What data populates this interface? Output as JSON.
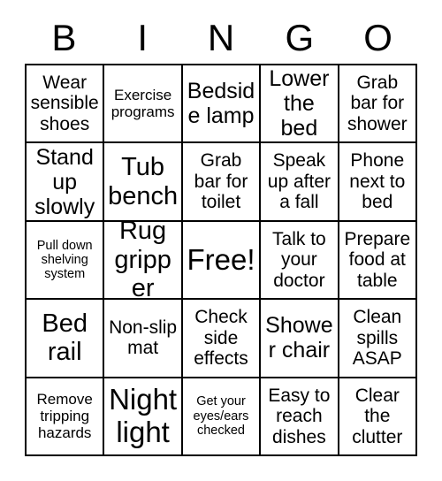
{
  "card": {
    "title": "BINGO",
    "header_letters": [
      "B",
      "I",
      "N",
      "G",
      "O"
    ],
    "grid_size": "5x5",
    "colors": {
      "background": "#ffffff",
      "border": "#000000",
      "text": "#000000"
    },
    "cells": [
      {
        "row": 1,
        "col": 1,
        "text": "Wear sensible shoes",
        "size": "m",
        "free": false
      },
      {
        "row": 1,
        "col": 2,
        "text": "Exercise programs",
        "size": "s",
        "free": false
      },
      {
        "row": 1,
        "col": 3,
        "text": "Bedside lamp",
        "size": "l",
        "free": false
      },
      {
        "row": 1,
        "col": 4,
        "text": "Lower the bed",
        "size": "l",
        "free": false
      },
      {
        "row": 1,
        "col": 5,
        "text": "Grab bar for shower",
        "size": "m",
        "free": false
      },
      {
        "row": 2,
        "col": 1,
        "text": "Stand up slowly",
        "size": "l",
        "free": false
      },
      {
        "row": 2,
        "col": 2,
        "text": "Tub bench",
        "size": "xl",
        "free": false
      },
      {
        "row": 2,
        "col": 3,
        "text": "Grab bar for toilet",
        "size": "m",
        "free": false
      },
      {
        "row": 2,
        "col": 4,
        "text": "Speak up after a fall",
        "size": "m",
        "free": false
      },
      {
        "row": 2,
        "col": 5,
        "text": "Phone next to bed",
        "size": "m",
        "free": false
      },
      {
        "row": 3,
        "col": 1,
        "text": "Pull down shelving system",
        "size": "xs",
        "free": false
      },
      {
        "row": 3,
        "col": 2,
        "text": "Rug gripper",
        "size": "xl",
        "free": false
      },
      {
        "row": 3,
        "col": 3,
        "text": "Free!",
        "size": "xxl",
        "free": true
      },
      {
        "row": 3,
        "col": 4,
        "text": "Talk to your doctor",
        "size": "m",
        "free": false
      },
      {
        "row": 3,
        "col": 5,
        "text": "Prepare food at table",
        "size": "m",
        "free": false
      },
      {
        "row": 4,
        "col": 1,
        "text": "Bed rail",
        "size": "xl",
        "free": false
      },
      {
        "row": 4,
        "col": 2,
        "text": "Non-slip mat",
        "size": "m",
        "free": false
      },
      {
        "row": 4,
        "col": 3,
        "text": "Check side effects",
        "size": "m",
        "free": false
      },
      {
        "row": 4,
        "col": 4,
        "text": "Shower chair",
        "size": "l",
        "free": false
      },
      {
        "row": 4,
        "col": 5,
        "text": "Clean spills ASAP",
        "size": "m",
        "free": false
      },
      {
        "row": 5,
        "col": 1,
        "text": "Remove tripping hazards",
        "size": "s",
        "free": false
      },
      {
        "row": 5,
        "col": 2,
        "text": "Night light",
        "size": "xxl",
        "free": false
      },
      {
        "row": 5,
        "col": 3,
        "text": "Get your eyes/ears checked",
        "size": "xs",
        "free": false
      },
      {
        "row": 5,
        "col": 4,
        "text": "Easy to reach dishes",
        "size": "m",
        "free": false
      },
      {
        "row": 5,
        "col": 5,
        "text": "Clear the clutter",
        "size": "m",
        "free": false
      }
    ]
  }
}
